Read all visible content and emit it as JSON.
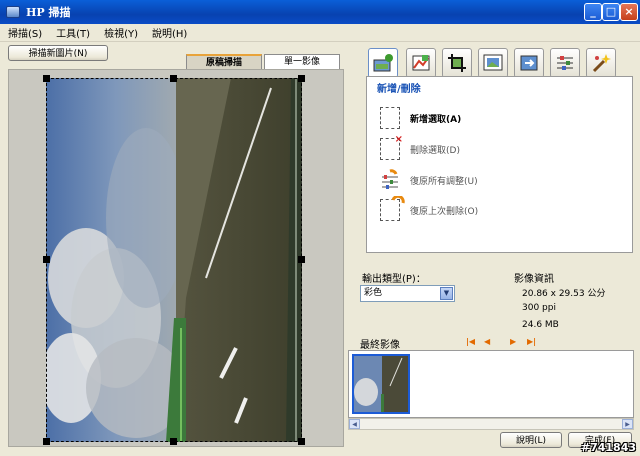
{
  "window": {
    "title": "HP 掃描"
  },
  "menu": [
    {
      "label": "掃描(S)"
    },
    {
      "label": "工具(T)"
    },
    {
      "label": "檢視(Y)"
    },
    {
      "label": "說明(H)"
    }
  ],
  "new_scan_button": "掃描新圖片(N)",
  "tabs": {
    "original": "原稿掃描",
    "single": "單一影像"
  },
  "task_panel": {
    "heading": "新增/刪除",
    "items": [
      {
        "label": "新增選取(A)",
        "bold": true,
        "icon": "add-selection-icon"
      },
      {
        "label": "刪除選取(D)",
        "icon": "delete-selection-icon"
      },
      {
        "label": "復原所有調整(U)",
        "icon": "undo-all-adjustments-icon"
      },
      {
        "label": "復原上次刪除(O)",
        "icon": "undo-last-delete-icon"
      }
    ]
  },
  "output": {
    "label": "輸出類型(P)：",
    "selected": "彩色"
  },
  "image_info": {
    "label": "影像資訊",
    "size": "20.86 x 29.53 公分",
    "resolution": "300 ppi",
    "file_size": "24.6 MB"
  },
  "final_images": {
    "label": "最終影像"
  },
  "buttons": {
    "help": "說明(L)",
    "finish": "完成(F)"
  },
  "watermark": "#741843",
  "icons": {
    "tools": [
      "add-delete-icon",
      "color-adjust-icon",
      "crop-icon",
      "resize-icon",
      "rotate-icon",
      "sliders-icon",
      "magic-wand-icon"
    ]
  },
  "colors": {
    "title_blue": "#0842b0",
    "task_heading": "#1852b5",
    "nav_arrow": "#e36a00"
  }
}
